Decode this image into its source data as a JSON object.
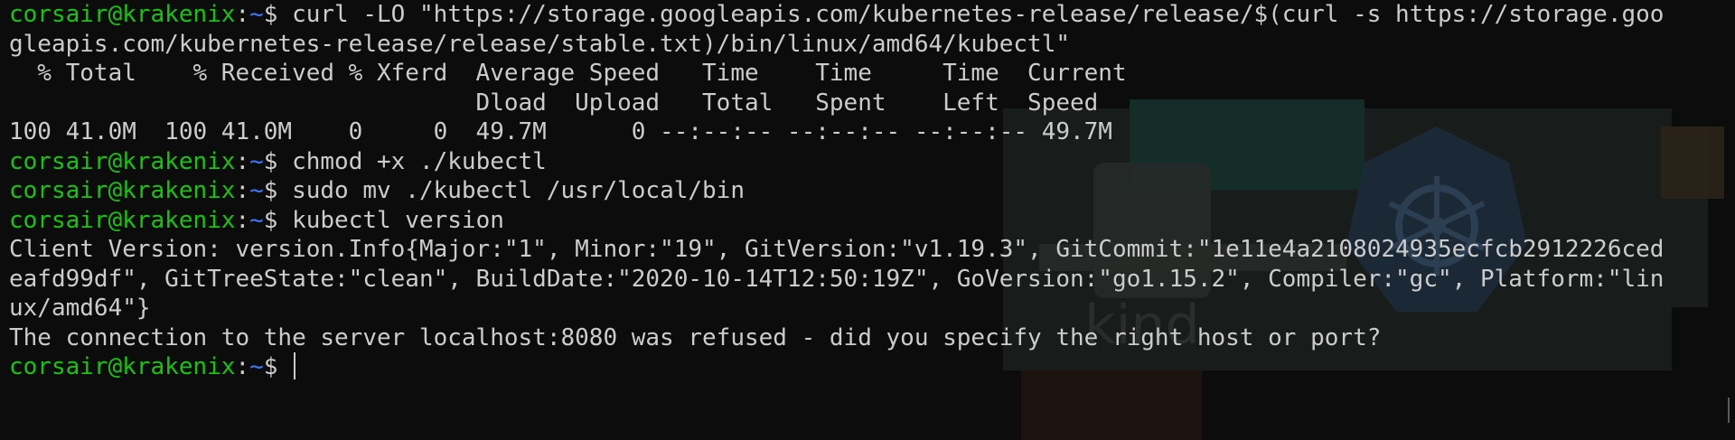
{
  "theme": {
    "background": "#0c0c0c",
    "foreground": "#cccccc",
    "user_color": "#16c60c",
    "path_color": "#3b78ff"
  },
  "prompt": {
    "user_host": "corsair@krakenix",
    "separator": ":",
    "path": "~",
    "symbol": "$ "
  },
  "watermark": {
    "label": "kind",
    "icon": "kubernetes-helm-wheel-icon"
  },
  "lines": [
    {
      "kind": "prompt",
      "command": "curl -LO \"https://storage.googleapis.com/kubernetes-release/release/$(curl -s https://storage.goo"
    },
    {
      "kind": "output",
      "text": "gleapis.com/kubernetes-release/release/stable.txt)/bin/linux/amd64/kubectl\""
    },
    {
      "kind": "output",
      "text": "  % Total    % Received % Xferd  Average Speed   Time    Time     Time  Current"
    },
    {
      "kind": "output",
      "text": "                                 Dload  Upload   Total   Spent    Left  Speed"
    },
    {
      "kind": "output",
      "text": "100 41.0M  100 41.0M    0     0  49.7M      0 --:--:-- --:--:-- --:--:-- 49.7M"
    },
    {
      "kind": "prompt",
      "command": "chmod +x ./kubectl"
    },
    {
      "kind": "prompt",
      "command": "sudo mv ./kubectl /usr/local/bin"
    },
    {
      "kind": "prompt",
      "command": "kubectl version"
    },
    {
      "kind": "output",
      "text": "Client Version: version.Info{Major:\"1\", Minor:\"19\", GitVersion:\"v1.19.3\", GitCommit:\"1e11e4a2108024935ecfcb2912226ced"
    },
    {
      "kind": "output",
      "text": "eafd99df\", GitTreeState:\"clean\", BuildDate:\"2020-10-14T12:50:19Z\", GoVersion:\"go1.15.2\", Compiler:\"gc\", Platform:\"lin"
    },
    {
      "kind": "output",
      "text": "ux/amd64\"}"
    },
    {
      "kind": "output",
      "text": "The connection to the server localhost:8080 was refused - did you specify the right host or port?"
    },
    {
      "kind": "prompt",
      "command": "",
      "cursor": true
    }
  ]
}
